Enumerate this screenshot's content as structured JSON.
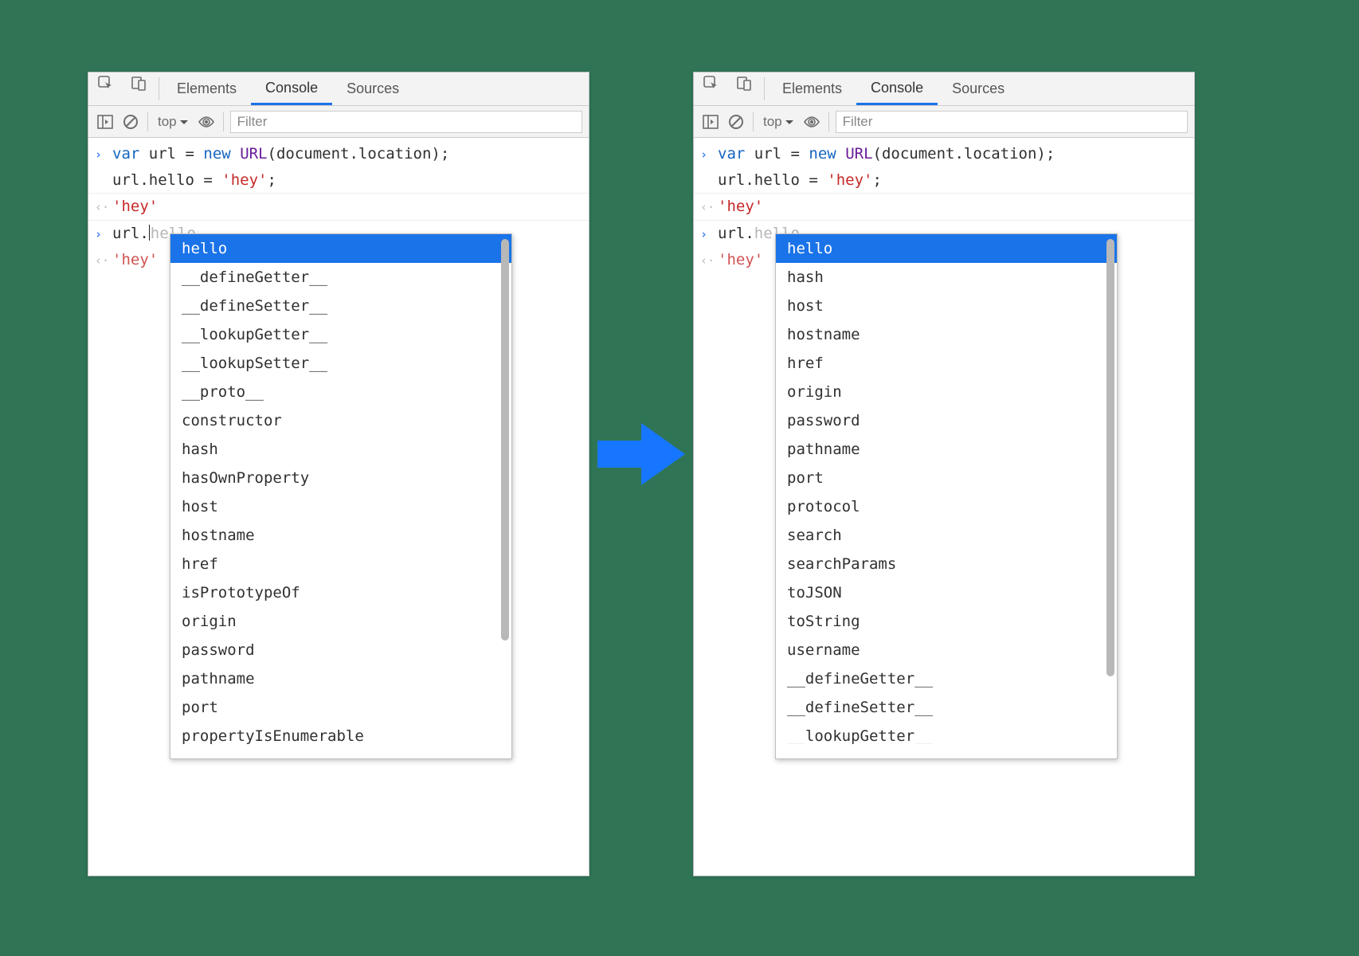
{
  "tabs": {
    "elements": "Elements",
    "console": "Console",
    "sources": "Sources"
  },
  "toolbar": {
    "context": "top",
    "filter_placeholder": "Filter"
  },
  "code": {
    "var": "var",
    "new": "new",
    "cls": "URL",
    "line1_rest": " url = ",
    "line1_tail": "(document.location);",
    "line2": "url.hello = ",
    "line2_str": "'hey'",
    "line2_semi": ";",
    "out1": "'hey'",
    "input2_pre": "url.",
    "input2_faint": "hello",
    "out2": "'hey'"
  },
  "left_completions": [
    "hello",
    "__defineGetter__",
    "__defineSetter__",
    "__lookupGetter__",
    "__lookupSetter__",
    "__proto__",
    "constructor",
    "hash",
    "hasOwnProperty",
    "host",
    "hostname",
    "href",
    "isPrototypeOf",
    "origin",
    "password",
    "pathname",
    "port",
    "propertyIsEnumerable"
  ],
  "right_completions": [
    "hello",
    "hash",
    "host",
    "hostname",
    "href",
    "origin",
    "password",
    "pathname",
    "port",
    "protocol",
    "search",
    "searchParams",
    "toJSON",
    "toString",
    "username",
    "__defineGetter__",
    "__defineSetter__",
    "__lookupGetter__"
  ]
}
